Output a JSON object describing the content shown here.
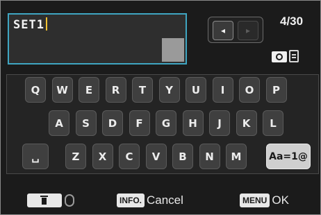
{
  "entry": {
    "text": "SET1"
  },
  "nav": {
    "left_glyph": "◂",
    "right_glyph": "▸"
  },
  "counter": "4/30",
  "status_icons": [
    "camera-icon",
    "card-icon"
  ],
  "keyboard": {
    "row1": [
      "Q",
      "W",
      "E",
      "R",
      "T",
      "Y",
      "U",
      "I",
      "O",
      "P"
    ],
    "row2": [
      "A",
      "S",
      "D",
      "F",
      "G",
      "H",
      "J",
      "K",
      "L"
    ],
    "row3": [
      "Z",
      "X",
      "C",
      "V",
      "B",
      "N",
      "M"
    ],
    "space_glyph": "␣",
    "mode_label": "Aa=1@"
  },
  "bottom": {
    "delete_icons": [
      "trash-icon",
      "dial-icon"
    ],
    "cancel_tag": "INFO.",
    "cancel_label": "Cancel",
    "ok_tag": "MENU",
    "ok_label": "OK"
  },
  "colors": {
    "entry_border": "#3fa6c2",
    "caret": "#f2c232",
    "background": "#1b1b1b"
  }
}
